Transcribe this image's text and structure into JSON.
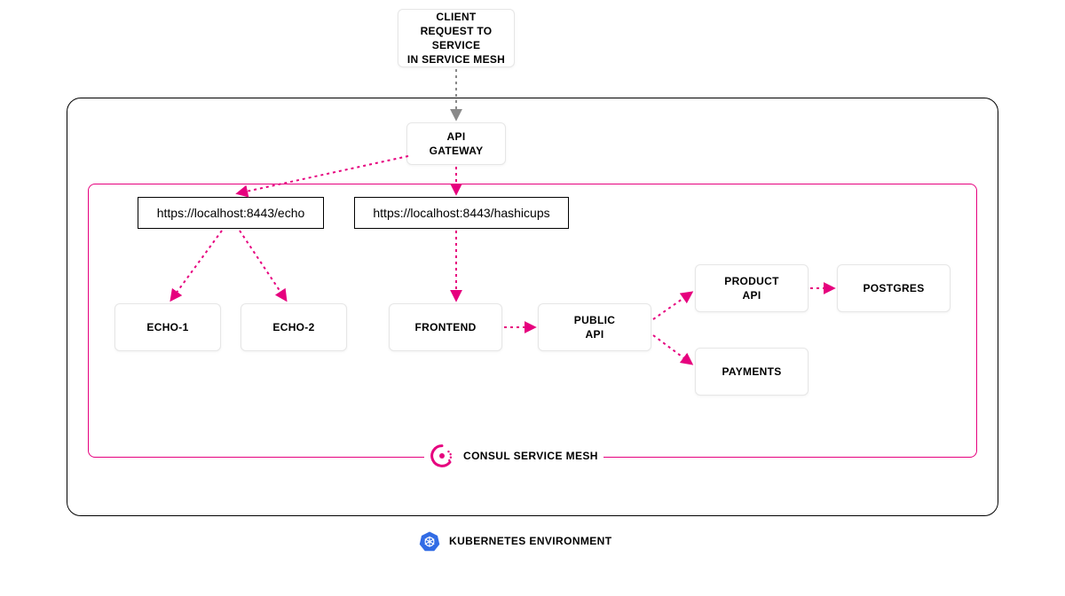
{
  "nodes": {
    "client": "CLIENT\nREQUEST TO SERVICE\nIN SERVICE MESH",
    "gateway": "API\nGATEWAY",
    "echo1": "ECHO-1",
    "echo2": "ECHO-2",
    "frontend": "FRONTEND",
    "publicapi": "PUBLIC\nAPI",
    "productapi": "PRODUCT\nAPI",
    "payments": "PAYMENTS",
    "postgres": "POSTGRES"
  },
  "urls": {
    "echo": "https://localhost:8443/echo",
    "hashicups": "https://localhost:8443/hashicups"
  },
  "env": {
    "consul": "CONSUL SERVICE MESH",
    "kube": "KUBERNETES ENVIRONMENT"
  },
  "colors": {
    "pink": "#e6007e",
    "gray": "#8a8a8a",
    "kube": "#326ce5"
  }
}
